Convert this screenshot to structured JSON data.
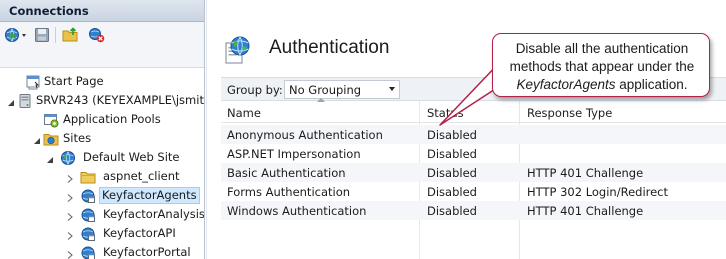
{
  "connections": {
    "header": "Connections",
    "tree": [
      {
        "label": "Start Page",
        "icon": "start-page-icon",
        "level": 1,
        "expander": "none"
      },
      {
        "label": "SRVR243 (KEYEXAMPLE\\jsmit",
        "icon": "server-icon",
        "level": 1,
        "expander": "expanded"
      },
      {
        "label": "Application Pools",
        "icon": "app-pools-icon",
        "level": 2,
        "expander": "none"
      },
      {
        "label": "Sites",
        "icon": "sites-folder-icon",
        "level": 2,
        "expander": "expanded"
      },
      {
        "label": "Default Web Site",
        "icon": "globe-icon",
        "level": 3,
        "expander": "expanded"
      },
      {
        "label": "aspnet_client",
        "icon": "folder-icon",
        "level": 4,
        "expander": "collapsed"
      },
      {
        "label": "KeyfactorAgents",
        "icon": "application-icon",
        "level": 4,
        "expander": "collapsed",
        "selected": true
      },
      {
        "label": "KeyfactorAnalysis",
        "icon": "application-icon",
        "level": 4,
        "expander": "collapsed"
      },
      {
        "label": "KeyfactorAPI",
        "icon": "application-icon",
        "level": 4,
        "expander": "collapsed"
      },
      {
        "label": "KeyfactorPortal",
        "icon": "application-icon",
        "level": 4,
        "expander": "collapsed"
      }
    ]
  },
  "feature": {
    "title": "Authentication",
    "group_by_label": "Group by:",
    "group_by_value": "No Grouping",
    "columns": [
      "Name",
      "Status",
      "Response Type"
    ],
    "rows": [
      {
        "name": "Anonymous Authentication",
        "status": "Disabled",
        "response": ""
      },
      {
        "name": "ASP.NET Impersonation",
        "status": "Disabled",
        "response": ""
      },
      {
        "name": "Basic Authentication",
        "status": "Disabled",
        "response": "HTTP 401 Challenge"
      },
      {
        "name": "Forms Authentication",
        "status": "Disabled",
        "response": "HTTP 302 Login/Redirect"
      },
      {
        "name": "Windows Authentication",
        "status": "Disabled",
        "response": "HTTP 401 Challenge"
      }
    ]
  },
  "callout": {
    "line1": "Disable all the authentication",
    "line2": "methods that appear under the",
    "line3_emphasis": "KeyfactorAgents",
    "line3_rest": " application."
  },
  "colors": {
    "callout_border": "#b22148",
    "selection": "#cde8ff",
    "header_gradient": "#c9d4e2"
  }
}
